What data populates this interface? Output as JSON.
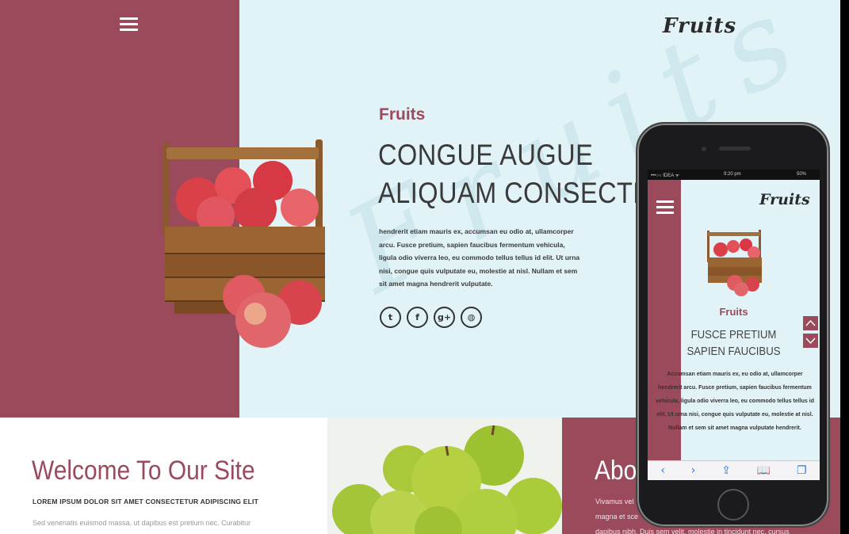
{
  "header": {
    "logo": "Fruits",
    "menu_icon": "hamburger-menu-icon"
  },
  "hero": {
    "subtitle": "Fruits",
    "title_line1": "CONGUE AUGUE",
    "title_line2": "ALIQUAM CONSECTETUR",
    "body": "hendrerit etiam mauris ex, accumsan eu odio at, ullamcorper arcu. Fusce pretium, sapien faucibus fermentum vehicula, ligula odio viverra leo, eu commodo tellus tellus id elit. Ut urna nisi, congue quis vulputate eu, molestie at nisl. Nullam et sem sit amet magna hendrerit vulputate.",
    "watermark": "Fruits",
    "social": [
      {
        "icon": "twitter-icon",
        "glyph": "t"
      },
      {
        "icon": "facebook-icon",
        "glyph": "f"
      },
      {
        "icon": "google-plus-icon",
        "glyph": "g+"
      },
      {
        "icon": "dribbble-icon",
        "glyph": "◍"
      }
    ]
  },
  "welcome": {
    "title": "Welcome To Our Site",
    "subtitle": "LOREM IPSUM DOLOR SIT AMET CONSECTETUR ADIPISCING ELIT",
    "body": "Sed venenatis euismod massa, ut dapibus est pretium nec. Curabitur"
  },
  "about": {
    "title": "About",
    "lines": [
      "Vivamus vel",
      "magna et sce",
      "dapibus nibh. Duis sem velit, molestie in tincidunt nec, cursus"
    ]
  },
  "phone": {
    "status": {
      "carrier": "•••○○ IDEA ᯤ",
      "time": "9:20 pm",
      "battery": "50%"
    },
    "logo": "Fruits",
    "subtitle": "Fruits",
    "title_line1": "FUSCE PRETIUM",
    "title_line2": "SAPIEN FAUCIBUS",
    "body": "Accumsan etiam mauris ex, eu odio at, ullamcorper hendrerit arcu. Fusce pretium, sapien faucibus fermentum vehicula, ligula odio viverra leo, eu commodo tellus tellus id elit. Ut urna nisi, congue quis vulputate eu, molestie at nisl. Nullam et sem sit amet magna vulputate hendrerit.",
    "browser": {
      "back": "‹",
      "forward": "›",
      "share": "⇪",
      "bookmarks": "📖",
      "tabs": "❐"
    }
  },
  "colors": {
    "accent": "#9b4a5c",
    "hero_bg": "#e2f3f7",
    "text_dark": "#3a3a3a"
  }
}
